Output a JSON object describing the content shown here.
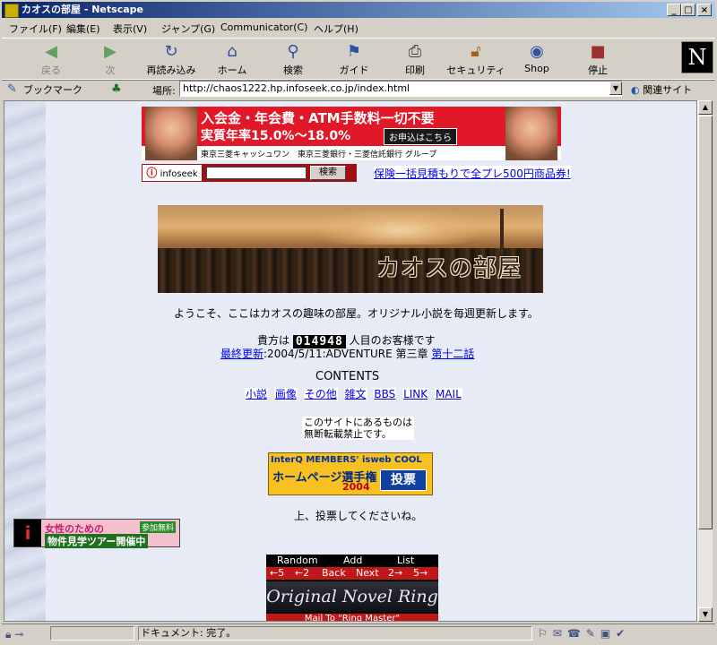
{
  "window": {
    "title": "カオスの部屋 - Netscape",
    "min": "_",
    "max": "□",
    "close": "×"
  },
  "menu": [
    "ファイル(F)",
    "編集(E)",
    "表示(V)",
    "ジャンプ(G)",
    "Communicator(C)",
    "ヘルプ(H)"
  ],
  "toolbar": {
    "back": "戻る",
    "forward": "次",
    "reload": "再読み込み",
    "home": "ホーム",
    "search": "検索",
    "guide": "ガイド",
    "print": "印刷",
    "security": "セキュリティ",
    "shop": "Shop",
    "stop": "停止",
    "logo": "N"
  },
  "location": {
    "bookmarks": "ブックマーク",
    "label": "場所:",
    "url": "http://chaos1222.hp.infoseek.co.jp/index.html",
    "related": "関連サイト"
  },
  "banner": {
    "line1": "入会金・年会費・ATM手数料一切不要",
    "line2": "実質年率15.0%～18.0%",
    "apply": "お申込はこちら",
    "line3": "東京三菱キャッシュワン　東京三菱銀行・三菱信託銀行 グループ"
  },
  "search": {
    "logo": "infoseek",
    "button": "検索",
    "ad_link": "保険一括見積もりで全プレ500円商品券!"
  },
  "hero": {
    "title": "カオスの部屋"
  },
  "welcome": "ようこそ、ここはカオスの趣味の部屋。オリジナル小説を毎週更新します。",
  "visitors": {
    "prefix": "貴方は",
    "count": "014948",
    "suffix": "人目のお客様です"
  },
  "update": {
    "label": "最終更新",
    "text": ":2004/5/11:ADVENTURE 第三章",
    "chapter": "第十二話"
  },
  "contents": {
    "heading": "CONTENTS",
    "links": [
      "小説",
      "画像",
      "その他",
      "雑文",
      "BBS",
      "LINK",
      "MAIL"
    ]
  },
  "notice": {
    "line1": "このサイトにあるものは",
    "line2": "無断転載禁止です。"
  },
  "vote": {
    "top": "InterQ MEMBERS' isweb COOL",
    "title": "ホームページ選手権",
    "year": "2004",
    "button": "投票",
    "caption": "上、投票してくださいね。"
  },
  "side_ad": {
    "logo": "i",
    "line1": "女性のための",
    "badge": "参加無料",
    "line2": "物件見学ツアー開催中"
  },
  "ring": {
    "random": "Random",
    "add": "Add",
    "list": "List",
    "prev5": "←5",
    "prev2": "←2",
    "back": "Back",
    "next": "Next",
    "next2": "2→",
    "next5": "5→",
    "logo": "Original Novel Ring",
    "mail": "Mail To \"Ring Master\""
  },
  "status": {
    "text": "ドキュメント: 完了。"
  }
}
